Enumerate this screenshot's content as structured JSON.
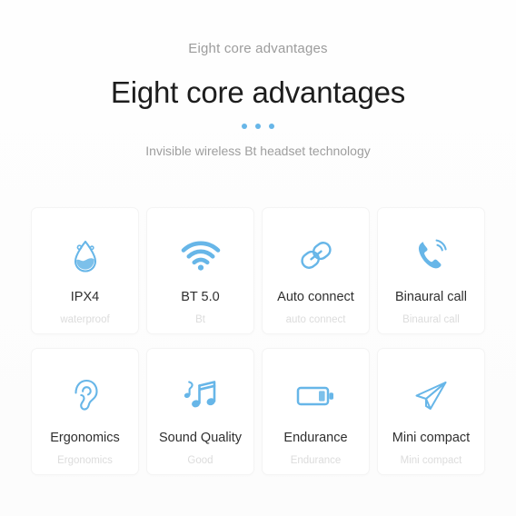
{
  "header": {
    "eyebrow": "Eight core advantages",
    "headline": "Eight core advantages",
    "subline": "Invisible wireless Bt headset technology",
    "accent_color": "#67b6e8",
    "dots_count": 3
  },
  "colors": {
    "accent": "#67b6e8",
    "page_background": "#fdfdfd",
    "card_background": "#ffffff",
    "title_text": "#2f2f2f",
    "subtitle_text": "#dcdcdc",
    "eyebrow_text": "#9c9c9c"
  },
  "cards": [
    {
      "icon": "water-drop-icon",
      "title": "IPX4",
      "subtitle": "waterproof"
    },
    {
      "icon": "wifi-icon",
      "title": "BT 5.0",
      "subtitle": "Bt"
    },
    {
      "icon": "link-icon",
      "title": "Auto connect",
      "subtitle": "auto connect"
    },
    {
      "icon": "phone-call-icon",
      "title": "Binaural call",
      "subtitle": "Binaural call"
    },
    {
      "icon": "ear-icon",
      "title": "Ergonomics",
      "subtitle": "Ergonomics"
    },
    {
      "icon": "music-note-icon",
      "title": "Sound Quality",
      "subtitle": "Good"
    },
    {
      "icon": "battery-icon",
      "title": "Endurance",
      "subtitle": "Endurance"
    },
    {
      "icon": "paper-plane-icon",
      "title": "Mini compact",
      "subtitle": "Mini compact"
    }
  ]
}
